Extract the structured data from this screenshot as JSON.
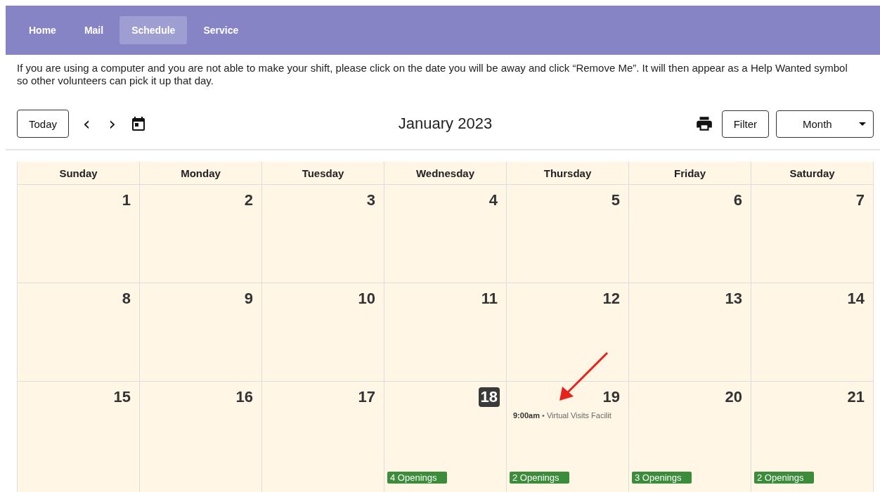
{
  "nav": [
    {
      "label": "Home",
      "selected": false
    },
    {
      "label": "Mail",
      "selected": false
    },
    {
      "label": "Schedule",
      "selected": true
    },
    {
      "label": "Service",
      "selected": false
    }
  ],
  "notice": "If you are using a computer and you are not able to make your shift, please click on the date you will be away and click “Remove Me”. It will then appear as a Help Wanted symbol so other volunteers can pick it up that day.",
  "toolbar": {
    "today": "Today",
    "prev": "‹",
    "next": "›",
    "title": "January 2023",
    "filter": "Filter",
    "view": "Month"
  },
  "weekdays": [
    "Sunday",
    "Monday",
    "Tuesday",
    "Wednesday",
    "Thursday",
    "Friday",
    "Saturday"
  ],
  "weeks": [
    [
      {
        "day": "1",
        "today": false
      },
      {
        "day": "2",
        "today": false
      },
      {
        "day": "3",
        "today": false
      },
      {
        "day": "4",
        "today": false
      },
      {
        "day": "5",
        "today": false
      },
      {
        "day": "6",
        "today": false
      },
      {
        "day": "7",
        "today": false
      }
    ],
    [
      {
        "day": "8",
        "today": false
      },
      {
        "day": "9",
        "today": false
      },
      {
        "day": "10",
        "today": false
      },
      {
        "day": "11",
        "today": false
      },
      {
        "day": "12",
        "today": false
      },
      {
        "day": "13",
        "today": false
      },
      {
        "day": "14",
        "today": false
      }
    ],
    [
      {
        "day": "15",
        "today": false
      },
      {
        "day": "16",
        "today": false
      },
      {
        "day": "17",
        "today": false
      },
      {
        "day": "18",
        "today": true,
        "openings": "4 Openings"
      },
      {
        "day": "19",
        "today": false,
        "events": [
          "**9:00am** • Virtual Visits Facilit"
        ],
        "openings": "2 Openings"
      },
      {
        "day": "20",
        "today": false,
        "openings": "3 Openings"
      },
      {
        "day": "21",
        "today": false,
        "openings": "2 Openings"
      }
    ]
  ],
  "annotations": [
    {
      "kind": "arrow"
    }
  ]
}
